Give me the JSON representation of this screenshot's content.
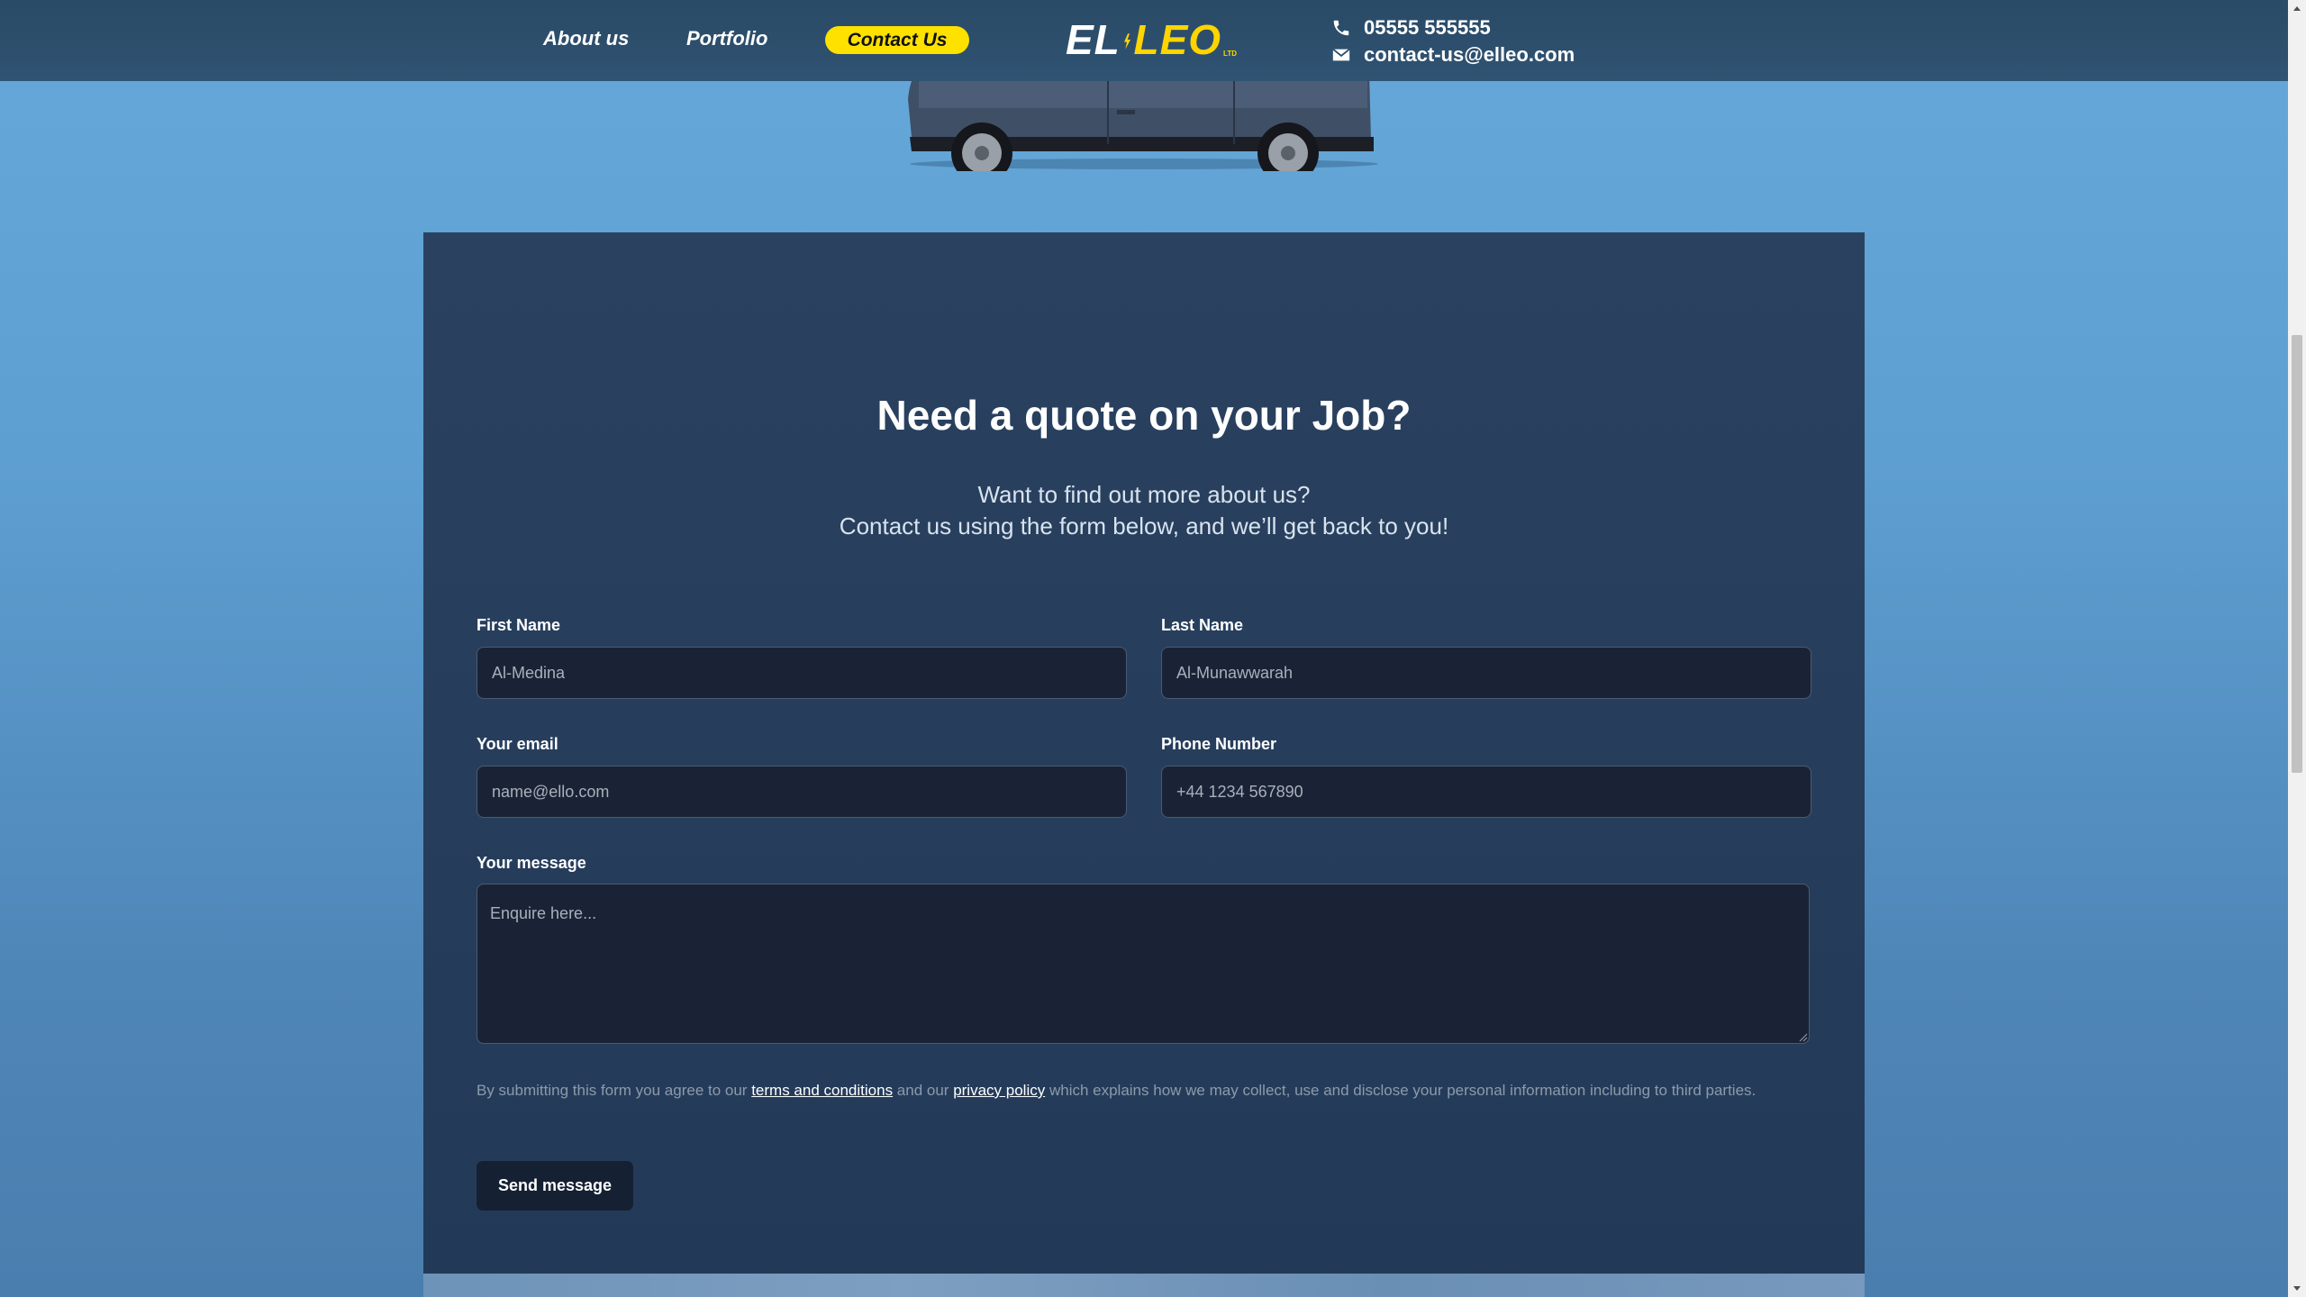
{
  "nav": {
    "about_label": "About us",
    "portfolio_label": "Portfolio",
    "contact_label": "Contact Us"
  },
  "logo": {
    "left_text": "EL",
    "right_text": "LEO",
    "suffix": "LTD"
  },
  "contact": {
    "phone": "05555 555555",
    "email": "contact-us@elleo.com",
    "phone_icon": "phone-icon",
    "email_icon": "envelope-icon"
  },
  "form": {
    "title": "Need a quote on your Job?",
    "subtitle_line1": "Want to find out more about us?",
    "subtitle_line2": "Contact us using the form below, and we’ll get back to you!",
    "first_name": {
      "label": "First Name",
      "placeholder": "Al-Medina"
    },
    "last_name": {
      "label": "Last Name",
      "placeholder": "Al-Munawwarah"
    },
    "email": {
      "label": "Your email",
      "placeholder": "name@ello.com"
    },
    "phone": {
      "label": "Phone Number",
      "placeholder": "+44 1234 567890"
    },
    "message": {
      "label": "Your message",
      "placeholder": "Enquire here..."
    },
    "disclaimer_prefix": "By submitting this form you agree to our ",
    "terms_link": "terms and conditions",
    "disclaimer_middle": " and our ",
    "privacy_link": "privacy policy",
    "disclaimer_suffix": " which explains how we may collect, use and disclose your personal information including to third parties.",
    "submit_label": "Send message"
  },
  "colors": {
    "accent": "#ffe100",
    "navbar": "#2c4d6b",
    "card": "#263f5d",
    "input_bg": "#1a2336"
  }
}
